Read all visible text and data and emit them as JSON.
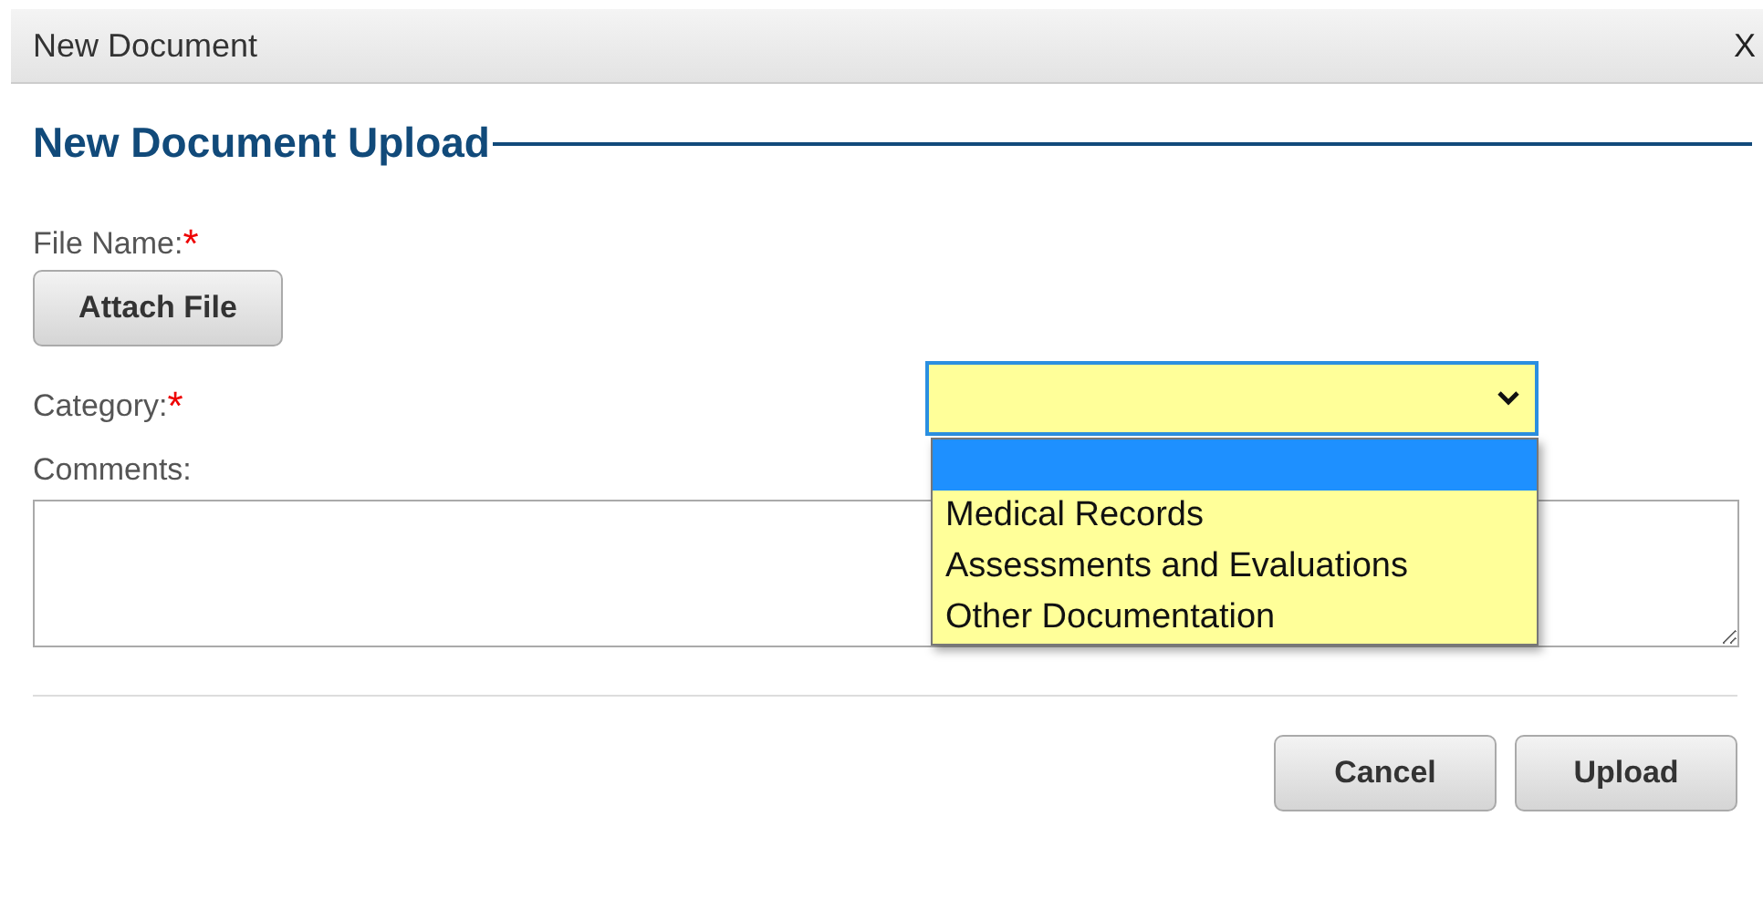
{
  "window": {
    "title": "New Document",
    "close": "X"
  },
  "heading": "New Document Upload",
  "fields": [
    {
      "kind": "file",
      "label": "File Name:",
      "required_mark": "*",
      "button": "Attach File"
    },
    {
      "kind": "select",
      "label": "Category:",
      "required_mark": "*",
      "expanded": true,
      "options": [
        {
          "selected": true
        },
        {
          "label": "Medical Records",
          "selected": false
        },
        {
          "label": "Assessments and Evaluations",
          "selected": false
        },
        {
          "label": "Other Documentation",
          "selected": false
        }
      ]
    },
    {
      "kind": "textarea",
      "label": "Comments:"
    }
  ],
  "buttons": [
    "Cancel",
    "Upload"
  ]
}
